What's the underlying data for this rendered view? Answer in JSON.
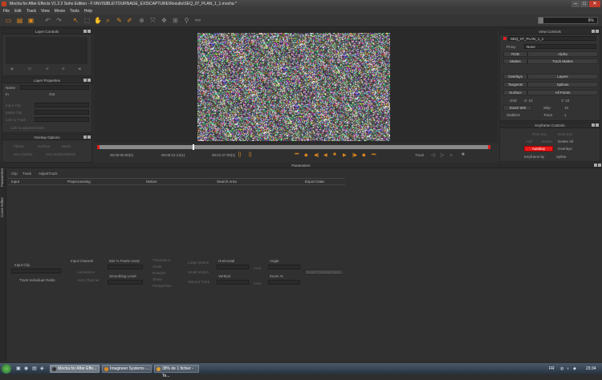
{
  "window": {
    "title": "Mocha for After Effects V1.2.2 Soho Edition - F:\\INVISIBLE\\TOURNAGE_EXS\\CAPTURE\\Results\\SEQ_07_PLAN_1_1.mocha *",
    "minimize": "–",
    "maximize": "□",
    "close": "✕"
  },
  "menu": [
    "File",
    "Edit",
    "Track",
    "View",
    "Movie",
    "Tools",
    "Help"
  ],
  "toolbar": {
    "zoom_level": "8%"
  },
  "layer_controls": {
    "title": "Layer Controls"
  },
  "layer_properties": {
    "title": "Layer Properties",
    "name_label": "Name",
    "in_label": "In",
    "out_label": "Out",
    "input_clip_label": "Input Clip",
    "matte_clip_label": "Matte Clip",
    "link_to_track_label": "Link to Track",
    "link_to_adjusted_label": "Link to adjusted track"
  },
  "overlay_options": {
    "title": "Overlay Options",
    "row1": [
      "Planar",
      "Surface",
      "Mesh"
    ],
    "row2": [
      "Use Outline",
      "Use Surface/Mesh"
    ]
  },
  "view_controls": {
    "title": "View Controls",
    "clip_name": "SEQ_07_PLAN_1_1",
    "proxy_label": "Proxy",
    "proxy_value": "None",
    "rgb": "RGB",
    "alpha": "Alpha",
    "mattes": "Mattes",
    "track_mattes": "Track Mattes",
    "overlays": "Overlays",
    "layers": "Layers",
    "tangents": "Tangents",
    "splines": "Splines",
    "surface": "Surface",
    "all_points": "All Points",
    "grid_label": "Grid",
    "grid_x": "X: 10",
    "grid_y": "Y: 10",
    "zoom_win": "Zoom Win",
    "stabilize": "Stabilize",
    "skip_label": "Skip",
    "skip_value": "10",
    "trace_label": "Trace",
    "trace_value": "1"
  },
  "keyframe_controls": {
    "title": "Keyframe Controls",
    "autokey": "Autokey",
    "delete_all": "Delete All",
    "keyframe_by": "Keyframe by",
    "keyframe_value": "Spline",
    "prev_key": "Prev Key",
    "next_key": "Next Key",
    "add": "Add",
    "delete": "Delete",
    "overlays": "Overlays"
  },
  "timeline": {
    "time_start": "00:00:00:00(1)",
    "time_current": "00:00:21:14(1)",
    "time_end": "00:01:27:09(1)",
    "track_label": "Track"
  },
  "parameters": {
    "title": "Parameters",
    "side_tabs": [
      "Parameters",
      "Curve Editor"
    ],
    "tabs": [
      "Clip",
      "Track",
      "AdjustTrack"
    ],
    "columns": [
      "Input",
      "Preprocessing",
      "Motion",
      "Search Area",
      "Export Data"
    ],
    "input_clip": "Input Clip",
    "track_individual_fields": "Track Individual Fields",
    "input_channel": "Input Channel",
    "luminance": "Luminance",
    "auto_channel": "Auto Channel",
    "min_pixels_used": "Min % Pixels Used",
    "smoothing_level": "Smoothing Level",
    "motion_options": [
      "Translation",
      "Scale",
      "Rotation",
      "Shear",
      "Perspective"
    ],
    "large_motion": "Large Motion",
    "small_motion": "Small Motion",
    "manual_track": "Manual Track",
    "horizontal": "Horizontal",
    "vertical": "Vertical",
    "auto": "Auto",
    "angle": "Angle",
    "zoom_pct": "Zoom %",
    "export_button": "Export Tracking Data..."
  },
  "taskbar": {
    "tasks": [
      "Mocha for After Effe...",
      "Imagineer Systems -...",
      "38% de 1 fichier - Te..."
    ],
    "lang": "FR",
    "clock": "23:34"
  },
  "colors": {
    "accent": "#e08a20",
    "autokey_red": "#e81c1c"
  }
}
